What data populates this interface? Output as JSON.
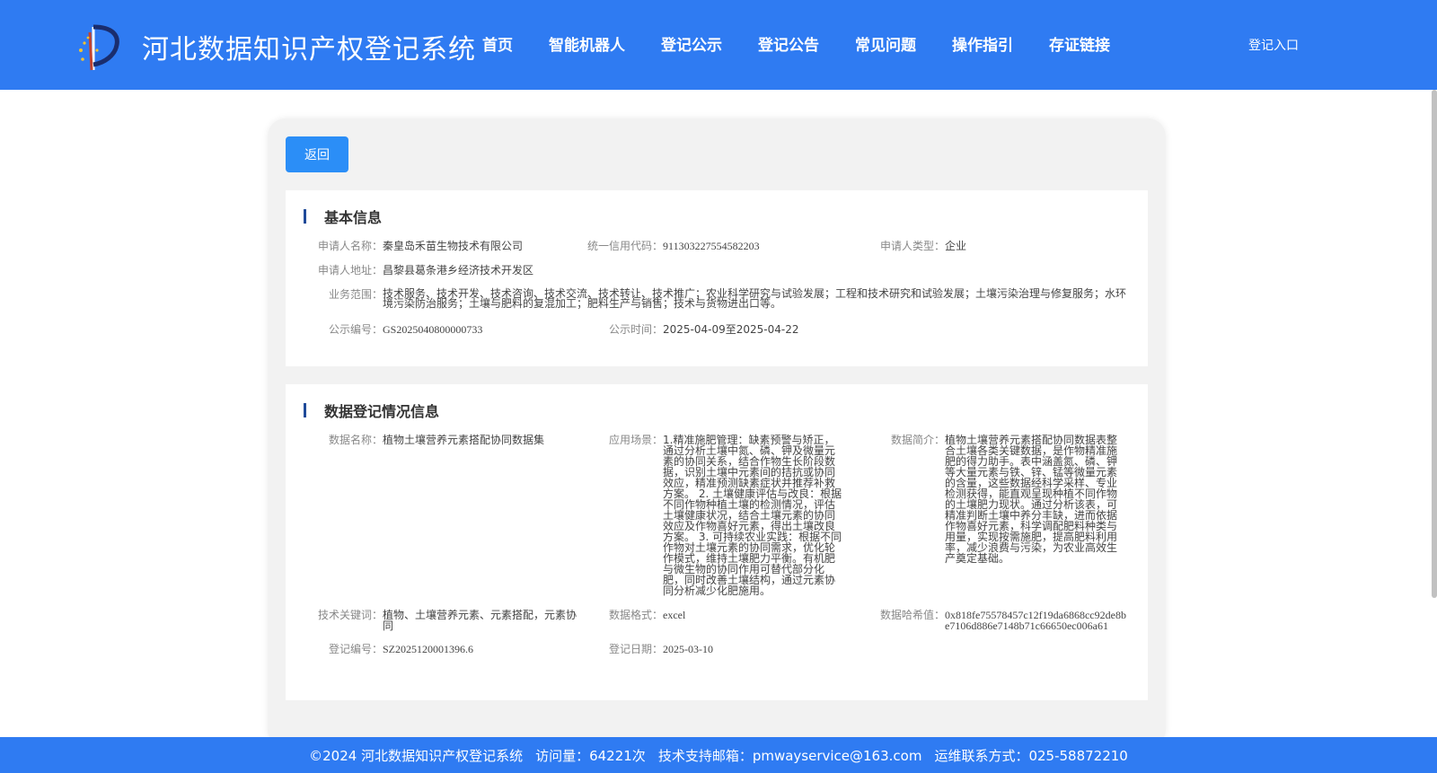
{
  "header": {
    "title": "河北数据知识产权登记系统",
    "nav": [
      "首页",
      "智能机器人",
      "登记公示",
      "登记公告",
      "常见问题",
      "操作指引",
      "存证链接"
    ],
    "login": "登记入口"
  },
  "back_label": "返回",
  "basic": {
    "title": "基本信息",
    "applicant_name_label": "申请人名称：",
    "applicant_name": "秦皇岛禾苗生物技术有限公司",
    "credit_code_label": "统一信用代码：",
    "credit_code": "911303227554582203",
    "applicant_type_label": "申请人类型：",
    "applicant_type": "企业",
    "address_label": "申请人地址：",
    "address": "昌黎县葛条港乡经济技术开发区",
    "scope_label": "业务范围：",
    "scope": "技术服务、技术开发、技术咨询、技术交流、技术转让、技术推广；农业科学研究与试验发展；工程和技术研究和试验发展；土壤污染治理与修复服务；水环境污染防治服务；土壤与肥料的复混加工；肥料生产与销售；技术与货物进出口等。",
    "pub_no_label": "公示编号：",
    "pub_no": "GS2025040800000733",
    "pub_time_label": "公示时间：",
    "pub_time": "2025-04-09至2025-04-22"
  },
  "registration": {
    "title": "数据登记情况信息",
    "data_name_label": "数据名称：",
    "data_name": "植物土壤营养元素搭配协同数据集",
    "scenario_label": "应用场景：",
    "scenario": "1.精准施肥管理：缺素预警与矫正，通过分析土壤中氮、磷、钾及微量元素的协同关系，结合作物生长阶段数据，识别土壤中元素间的拮抗或协同效应，精准预测缺素症状并推荐补救方案。 2. 土壤健康评估与改良：根据不同作物种植土壤的检测情况，评估土壤健康状况，结合土壤元素的协同效应及作物喜好元素，得出土壤改良方案。 3. 可持续农业实践：根据不同作物对土壤元素的协同需求，优化轮作模式，维持土壤肥力平衡。有机肥与微生物的协同作用可替代部分化肥，同时改善土壤结构，通过元素协同分析减少化肥施用。",
    "intro_label": "数据简介：",
    "intro": "植物土壤营养元素搭配协同数据表整合土壤各类关键数据，是作物精准施肥的得力助手。表中涵盖氮、磷、钾等大量元素与铁、锌、锰等微量元素的含量，这些数据经科学采样、专业检测获得，能直观呈现种植不同作物的土壤肥力现状。通过分析该表，可精准判断土壤中养分丰缺，进而依据作物喜好元素，科学调配肥料种类与用量，实现按需施肥，提高肥料利用率，减少浪费与污染，为农业高效生产奠定基础。",
    "keywords_label": "技术关键词：",
    "keywords": "植物、土壤营养元素、元素搭配，元素协同",
    "format_label": "数据格式：",
    "format": "excel",
    "hash_label": "数据哈希值：",
    "hash": "0x818fe75578457c12f19da6868cc92de8be7106d886e7148b71c66650ec006a61",
    "reg_no_label": "登记编号：",
    "reg_no": "SZ2025120001396.6",
    "reg_date_label": "登记日期：",
    "reg_date": "2025-03-10"
  },
  "footer": {
    "copyright": "©2024 河北数据知识产权登记系统",
    "visits": "访问量：64221次",
    "email": "技术支持邮箱：pmwayservice@163.com",
    "phone": "运维联系方式：025-58872210"
  },
  "colors": {
    "header_bg": "#2f7bf2",
    "button_bg": "#2b8ef7",
    "section_bar": "#1f4a99"
  }
}
